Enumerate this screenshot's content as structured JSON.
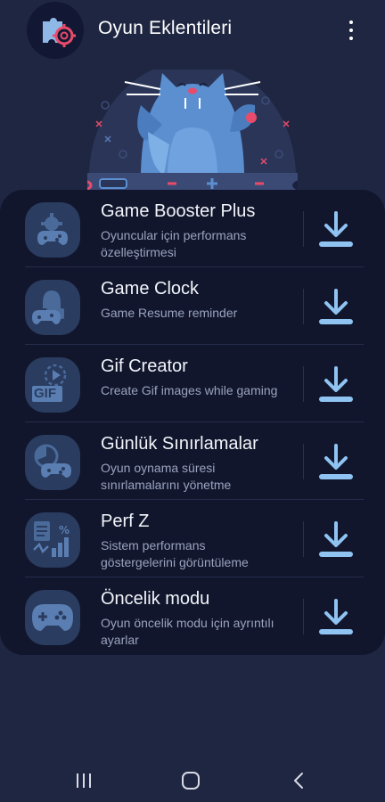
{
  "header": {
    "title": "Oyun Eklentileri",
    "app_icon": "puzzle-gear-icon",
    "more_icon": "more-vert-icon"
  },
  "hero": {
    "image": "cat-game-controller-illustration"
  },
  "addons": [
    {
      "title": "Game Booster Plus",
      "description": "Oyuncular için performans özelleştirmesi",
      "icon": "gear-gamepad-icon",
      "action_icon": "download-icon"
    },
    {
      "title": "Game Clock",
      "description": "Game Resume reminder",
      "icon": "bell-gamepad-icon",
      "action_icon": "download-icon"
    },
    {
      "title": "Gif Creator",
      "description": "Create Gif images while gaming",
      "icon": "gif-play-icon",
      "gif_text": "GIF",
      "action_icon": "download-icon"
    },
    {
      "title": "Günlük Sınırlamalar",
      "description": "Oyun oynama süresi sınırlamalarını yönetme",
      "icon": "timer-gamepad-icon",
      "action_icon": "download-icon"
    },
    {
      "title": "Perf Z",
      "description": "Sistem performans göstergelerini görüntüleme",
      "icon": "stats-chart-icon",
      "action_icon": "download-icon"
    },
    {
      "title": "Öncelik modu",
      "description": "Oyun öncelik modu için ayrıntılı ayarlar",
      "icon": "gamepad-priority-icon",
      "action_icon": "download-icon"
    }
  ],
  "navbar": {
    "recents_icon": "recents-icon",
    "home_icon": "home-icon",
    "back_icon": "back-icon"
  },
  "colors": {
    "background": "#1f2641",
    "card": "#11162c",
    "icon_tile": "#2a3c5f",
    "download": "#8fc3f2",
    "accent_red": "#e94b6b"
  }
}
